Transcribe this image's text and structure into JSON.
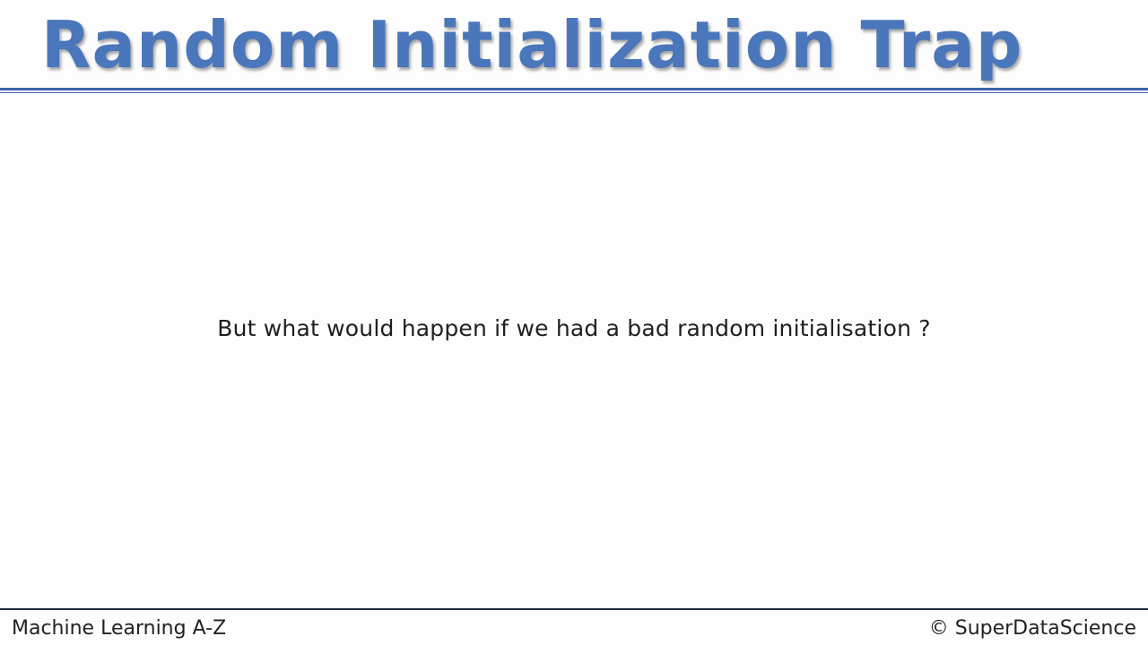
{
  "slide": {
    "title": "Random Initialization Trap",
    "body": "But what would happen if we had a bad random initialisation ?"
  },
  "footer": {
    "left": "Machine Learning A-Z",
    "right": "© SuperDataScience"
  },
  "colors": {
    "title": "#4a76bb",
    "rule": "#3c64a8",
    "footer_rule": "#1d2b45",
    "background": "#fdfdfd"
  }
}
